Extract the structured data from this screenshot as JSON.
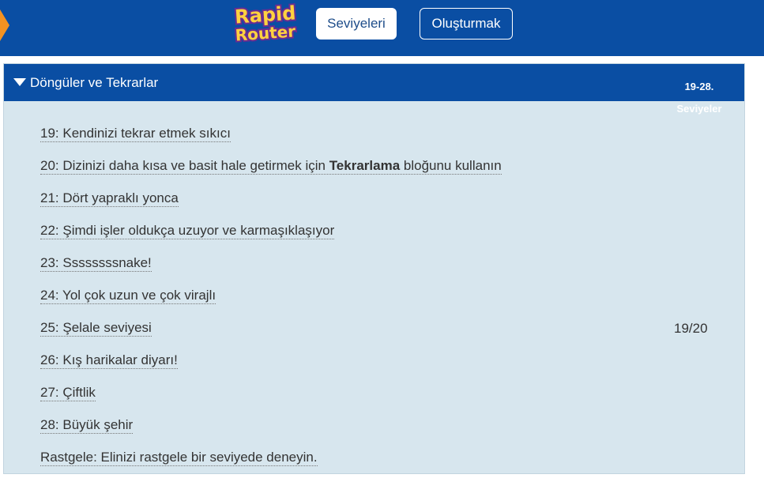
{
  "header": {
    "logo": {
      "line1": "Rapid",
      "line2": "Router"
    },
    "nav": [
      {
        "label": "Seviyeleri"
      },
      {
        "label": "Oluşturmak"
      }
    ]
  },
  "episode": {
    "title": "Döngüler ve Tekrarlar",
    "range": "19-28. Seviyeler",
    "score": "19/20",
    "levels": [
      {
        "label": "19: Kendinizi tekrar etmek sıkıcı"
      },
      {
        "label_pre": "20: Dizinizi daha kısa ve basit hale getirmek için ",
        "label_bold": "Tekrarlama",
        "label_post": " bloğunu kullanın"
      },
      {
        "label": "21: Dört yapraklı yonca"
      },
      {
        "label": "22: Şimdi işler oldukça uzuyor ve karmaşıklaşıyor"
      },
      {
        "label": "23: Ssssssssnake!"
      },
      {
        "label": "24: Yol çok uzun ve çok virajlı"
      },
      {
        "label": "25: Şelale seviyesi"
      },
      {
        "label": "26: Kış harikalar diyarı!"
      },
      {
        "label": "27: Çiftlik"
      },
      {
        "label": "28: Büyük şehir"
      },
      {
        "label": "Rastgele: Elinizi rastgele bir seviyede deneyin."
      }
    ]
  },
  "colors": {
    "header_blue": "#0a4ea3",
    "panel_bg": "#d7e6ee",
    "accent_orange": "#f39221",
    "logo_purple": "#6a2c91",
    "logo_yellow": "#ffd23f"
  },
  "icons": {
    "toggle": "caret-down-icon"
  }
}
